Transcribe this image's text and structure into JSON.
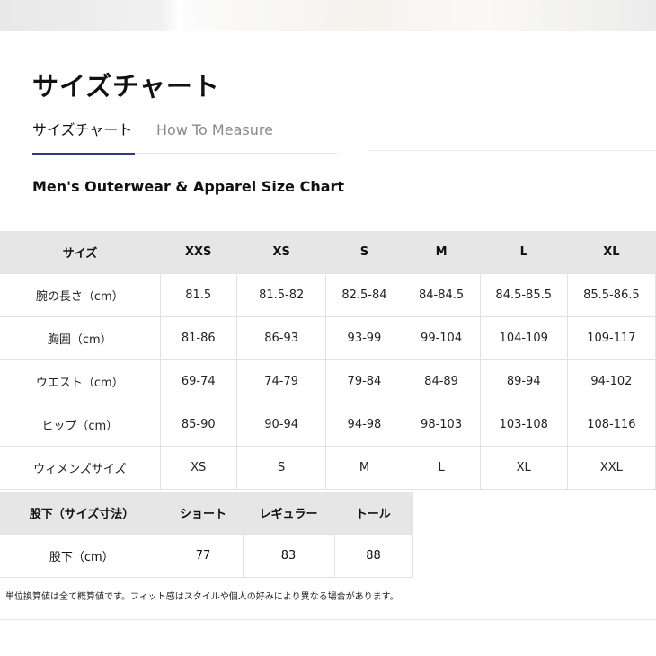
{
  "page": {
    "title": "サイズチャート",
    "tabs": [
      {
        "label": "サイズチャート",
        "active": true
      },
      {
        "label": "How To Measure",
        "active": false
      }
    ],
    "chart_title": "Men's Outerwear & Apparel Size Chart",
    "footnote": "単位換算値は全て概算値です。フィット感はスタイルや個人の好みにより異なる場合があります。",
    "accent_color": "#2c3a82",
    "header_bg_color": "#e6e6e6"
  },
  "size_table": {
    "headers": [
      "サイズ",
      "XXS",
      "XS",
      "S",
      "M",
      "L",
      "XL"
    ],
    "rows": [
      [
        "腕の長さ（cm）",
        "81.5",
        "81.5-82",
        "82.5-84",
        "84-84.5",
        "84.5-85.5",
        "85.5-86.5"
      ],
      [
        "胸囲（cm）",
        "81-86",
        "86-93",
        "93-99",
        "99-104",
        "104-109",
        "109-117"
      ],
      [
        "ウエスト（cm）",
        "69-74",
        "74-79",
        "79-84",
        "84-89",
        "89-94",
        "94-102"
      ],
      [
        "ヒップ（cm）",
        "85-90",
        "90-94",
        "94-98",
        "98-103",
        "103-108",
        "108-116"
      ],
      [
        "ウィメンズサイズ",
        "XS",
        "S",
        "M",
        "L",
        "XL",
        "XXL"
      ]
    ]
  },
  "inseam_table": {
    "headers": [
      "股下（サイズ寸法）",
      "ショート",
      "レギュラー",
      "トール"
    ],
    "rows": [
      [
        "股下（cm）",
        "77",
        "83",
        "88"
      ]
    ]
  }
}
